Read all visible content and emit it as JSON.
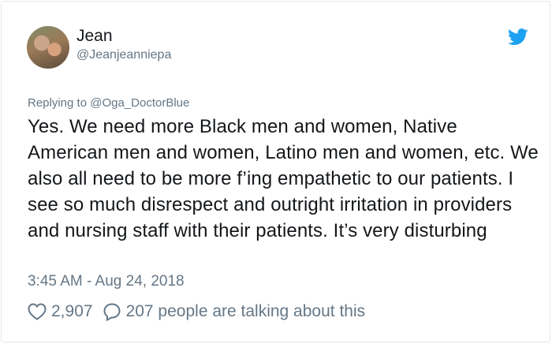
{
  "user": {
    "display_name": "Jean",
    "handle": "@Jeanjeanniepa"
  },
  "reply": {
    "prefix": "Replying to",
    "mention": "@Oga_DoctorBlue"
  },
  "tweet": {
    "text": "Yes. We need more Black men and women, Native American men and women, Latino men and women, etc. We also all need to be more f’ing empathetic to our patients. I see so much disrespect and outright irritation in providers and nursing staff with their patients. It’s very disturbing",
    "timestamp": "3:45 AM - Aug 24, 2018"
  },
  "stats": {
    "likes": "2,907",
    "talking": "207 people are talking about this"
  },
  "icons": {
    "brand": "twitter-bird-icon",
    "like": "heart-icon",
    "reply": "speech-bubble-icon"
  },
  "colors": {
    "brand": "#1da1f2",
    "text": "#14171a",
    "secondary": "#657786"
  }
}
